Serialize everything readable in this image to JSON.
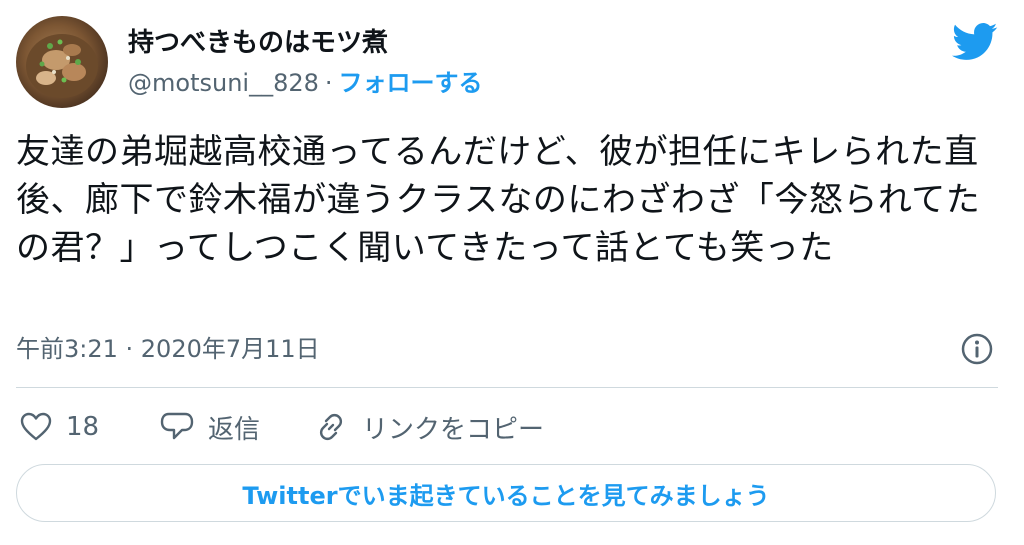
{
  "author": {
    "display_name": "持つべきものはモツ煮",
    "handle": "@motsuni__828",
    "separator": "·",
    "follow_label": "フォローする",
    "avatar_icon": "avatar-photo-icon"
  },
  "tweet": {
    "text": "友達の弟堀越高校通ってるんだけど、彼が担任にキレられた直後、廊下で鈴木福が違うクラスなのにわざわざ「今怒られてたの君？」ってしつこく聞いてきたって話とても笑った",
    "timestamp": "午前3:21 · 2020年7月11日"
  },
  "actions": {
    "like_count": "18",
    "reply_label": "返信",
    "copy_link_label": "リンクをコピー"
  },
  "cta": {
    "label": "Twitterでいま起きていることを見てみましょう"
  },
  "colors": {
    "accent": "#1d9bf0",
    "secondary_text": "#536471",
    "divider": "#cfd9de"
  },
  "icons": {
    "logo": "twitter-bird-icon",
    "info": "info-icon",
    "like": "heart-icon",
    "reply": "speech-bubble-icon",
    "copy_link": "link-icon"
  }
}
